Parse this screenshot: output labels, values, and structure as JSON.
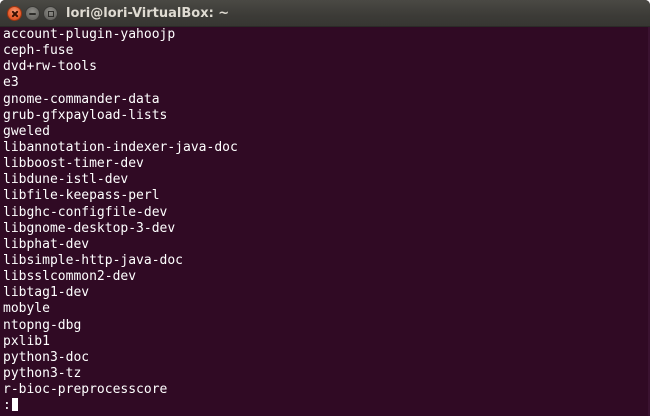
{
  "window": {
    "title": "lori@lori-VirtualBox: ~",
    "buttons": {
      "close": "close-icon",
      "minimize": "minimize-icon",
      "maximize": "maximize-icon"
    },
    "colors": {
      "terminal_bg": "#300a24",
      "titlebar_bg": "#3c3b37",
      "close_button": "#e9602f",
      "text": "#ffffff"
    }
  },
  "terminal": {
    "lines": [
      "account-plugin-yahoojp",
      "ceph-fuse",
      "dvd+rw-tools",
      "e3",
      "gnome-commander-data",
      "grub-gfxpayload-lists",
      "gweled",
      "libannotation-indexer-java-doc",
      "libboost-timer-dev",
      "libdune-istl-dev",
      "libfile-keepass-perl",
      "libghc-configfile-dev",
      "libgnome-desktop-3-dev",
      "libphat-dev",
      "libsimple-http-java-doc",
      "libsslcommon2-dev",
      "libtag1-dev",
      "mobyle",
      "ntopng-dbg",
      "pxlib1",
      "python3-doc",
      "python3-tz",
      "r-bioc-preprocesscore"
    ],
    "pager_prompt": ":"
  }
}
